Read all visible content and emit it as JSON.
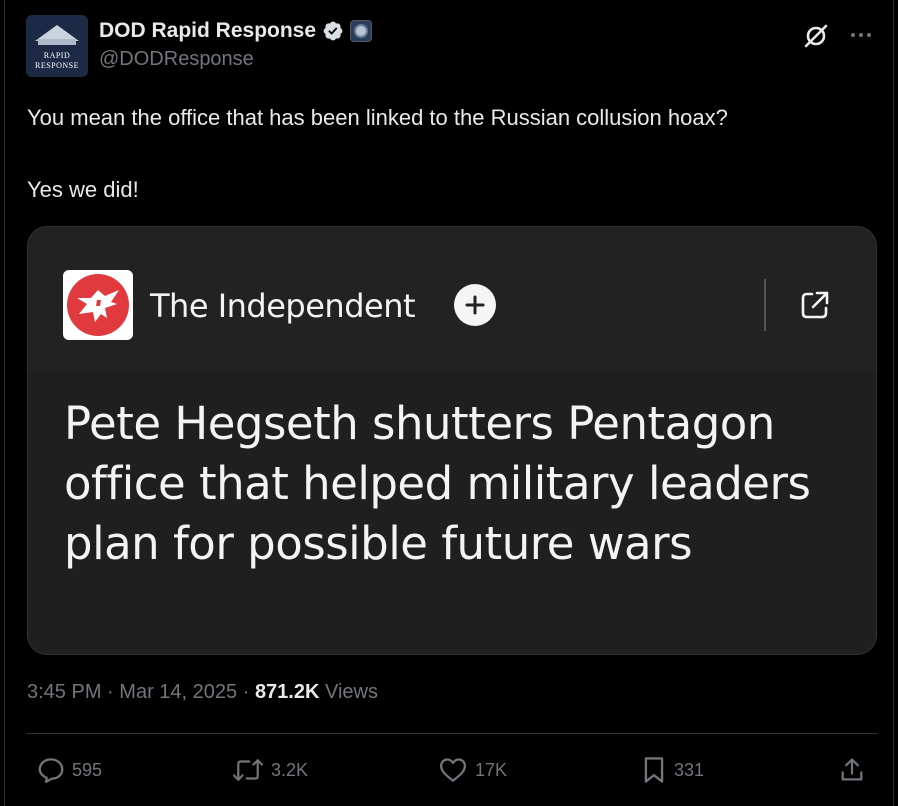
{
  "author": {
    "display_name": "DOD Rapid Response",
    "handle": "@DODResponse",
    "avatar_text_line1": "RAPID",
    "avatar_text_line2": "RESPONSE"
  },
  "tweet": {
    "line1": "You mean the office that has been linked to the Russian collusion hoax?",
    "line2": "Yes we did!"
  },
  "card": {
    "publisher": "The Independent",
    "headline": "Pete Hegseth shutters Pentagon office that helped military leaders plan for possible future wars"
  },
  "meta": {
    "time": "3:45 PM",
    "date": "Mar 14, 2025",
    "views_count": "871.2K",
    "views_label": "Views",
    "separator": "·"
  },
  "actions": {
    "replies": "595",
    "reposts": "3.2K",
    "likes": "17K",
    "bookmarks": "331"
  },
  "colors": {
    "background": "#000000",
    "text": "#e7e9ea",
    "secondary": "#71767b",
    "verified_blue": "#1d9bf0",
    "publisher_red": "#e03a3e"
  }
}
